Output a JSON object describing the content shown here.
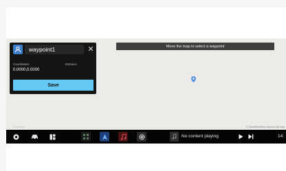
{
  "map": {
    "instruction": "Move the map to select a waypoint",
    "attribution_left": "©mapbox",
    "attribution_right": "© OpenStreetMap  Improve this map"
  },
  "panel": {
    "waypoint_name": "waypoint1",
    "close_glyph": "✕",
    "coordinates_label": "Coordinates",
    "distance_label": "Distance",
    "coordinates_value": "0.0000,0.0000",
    "save_label": "Save"
  },
  "taskbar": {
    "media_text": "No content playing",
    "clock": "14:"
  },
  "colors": {
    "accent": "#64c9f4",
    "waypoint_icon_bg": "#3d7fcc",
    "panel_bg": "#141414",
    "taskbar_bg": "#050505",
    "map_bg": "#ecebe8"
  }
}
